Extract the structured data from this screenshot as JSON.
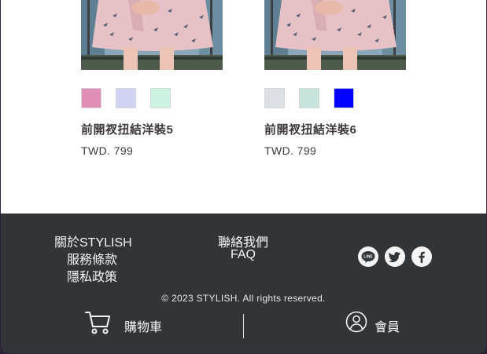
{
  "products": [
    {
      "title": "前開衩扭結洋裝5",
      "price": "TWD. 799",
      "swatches": [
        "#DF8FB5",
        "#D3D3F4",
        "#CCF2E1"
      ]
    },
    {
      "title": "前開衩扭結洋裝6",
      "price": "TWD. 799",
      "swatches": [
        "#DCDFE4",
        "#C8E3DB",
        "#0000FF"
      ]
    }
  ],
  "footer": {
    "links_col1": [
      "關於STYLISH",
      "服務條款",
      "隱私政策"
    ],
    "links_col2": [
      "聯絡我們",
      "FAQ"
    ],
    "social": [
      "line-icon",
      "twitter-icon",
      "facebook-icon"
    ],
    "copyright": "© 2023 STYLISH. All rights reserved.",
    "cart_label": "購物車",
    "member_label": "會員"
  },
  "colors": {
    "footer_bg": "#313538",
    "page_bg": "#FFFFFF",
    "text_dark": "#3F3A3A"
  }
}
